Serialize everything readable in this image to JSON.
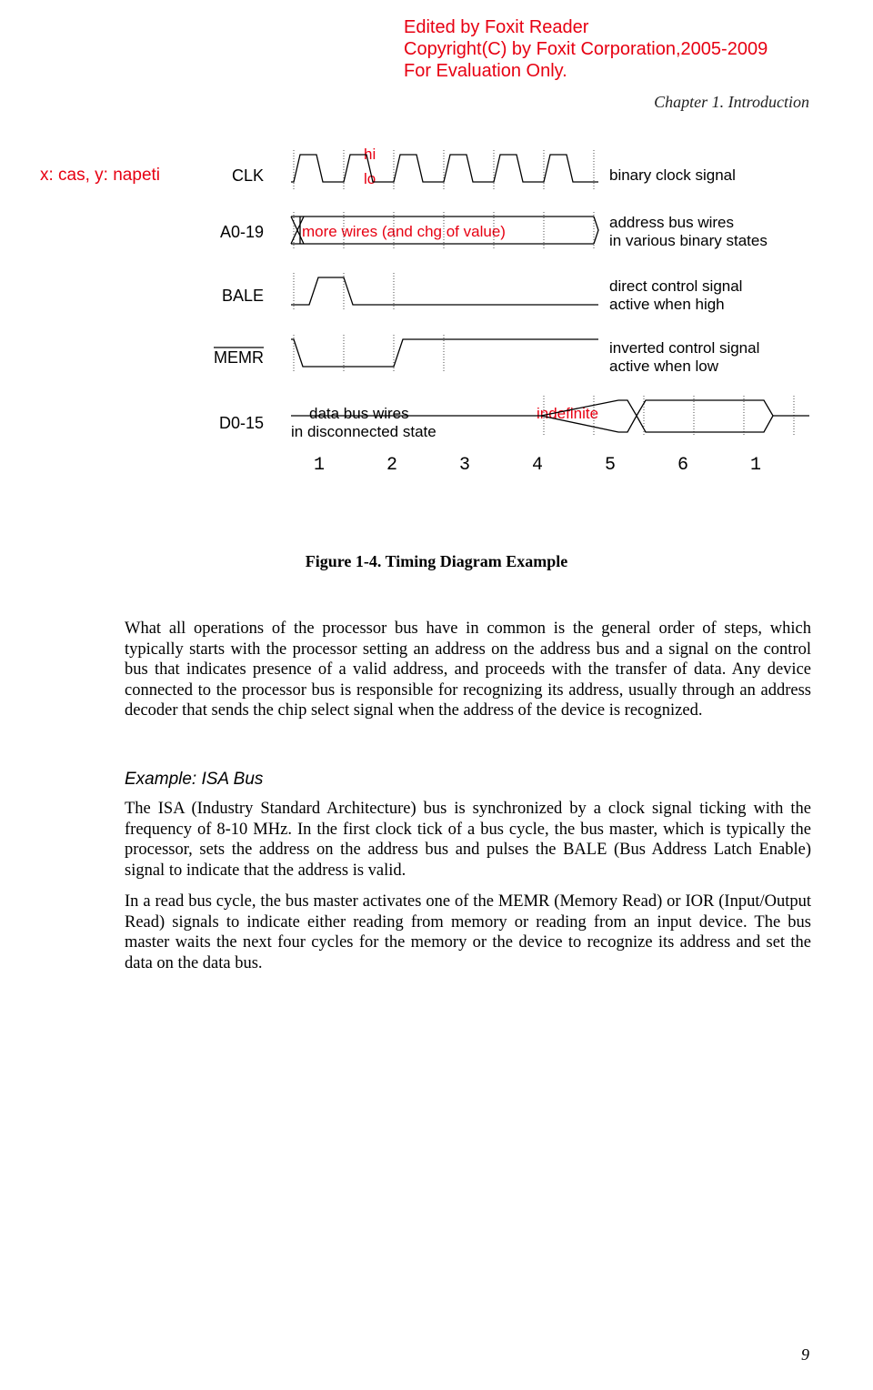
{
  "watermark": {
    "line1": "Edited by Foxit Reader",
    "line2": "Copyright(C) by Foxit Corporation,2005-2009",
    "line3": "For Evaluation Only."
  },
  "chapter": "Chapter 1. Introduction",
  "annotation": "x: cas, y: napeti",
  "signals": {
    "clk": {
      "label": "CLK",
      "hi": "hi",
      "lo": "lo",
      "desc": "binary clock signal"
    },
    "a019": {
      "label": "A0-19",
      "note": "more wires (and chg of value)",
      "desc1": "address bus wires",
      "desc2": "in various binary states"
    },
    "bale": {
      "label": "BALE",
      "desc1": "direct control signal",
      "desc2": "active when high"
    },
    "memr": {
      "label": "MEMR",
      "desc1": "inverted control signal",
      "desc2": "active when low"
    },
    "d015": {
      "label": "D0-15",
      "desc1": "data bus wires",
      "desc2": "in disconnected state",
      "indef": "indefinite"
    }
  },
  "ticks": [
    "1",
    "2",
    "3",
    "4",
    "5",
    "6",
    "1"
  ],
  "caption": "Figure 1-4. Timing Diagram Example",
  "para1": "What all operations of the processor bus have in common is the general order of steps, which typically starts with the processor setting an address on the address bus and a signal on the control bus that indicates presence of a valid address, and proceeds with the transfer of data. Any device connected to the processor bus is responsible for recognizing its address, usually through an address decoder that sends the chip select signal when the address of the device is recognized.",
  "example_heading": "Example: ISA Bus",
  "para2": "The ISA (Industry Standard Architecture) bus is synchronized by a clock signal ticking with the frequency of 8-10 MHz. In the first clock tick of a bus cycle, the bus master, which is typically the processor, sets the address on the address bus and pulses the BALE (Bus Address Latch Enable) signal to indicate that the address is valid.",
  "para3": "In a read bus cycle, the bus master activates one of the MEMR (Memory Read) or IOR (Input/Output Read) signals to indicate either reading from memory or reading from an input device. The bus master waits the next four cycles for the memory or the device to recognize its address and set the data on the data bus.",
  "pagenum": "9"
}
